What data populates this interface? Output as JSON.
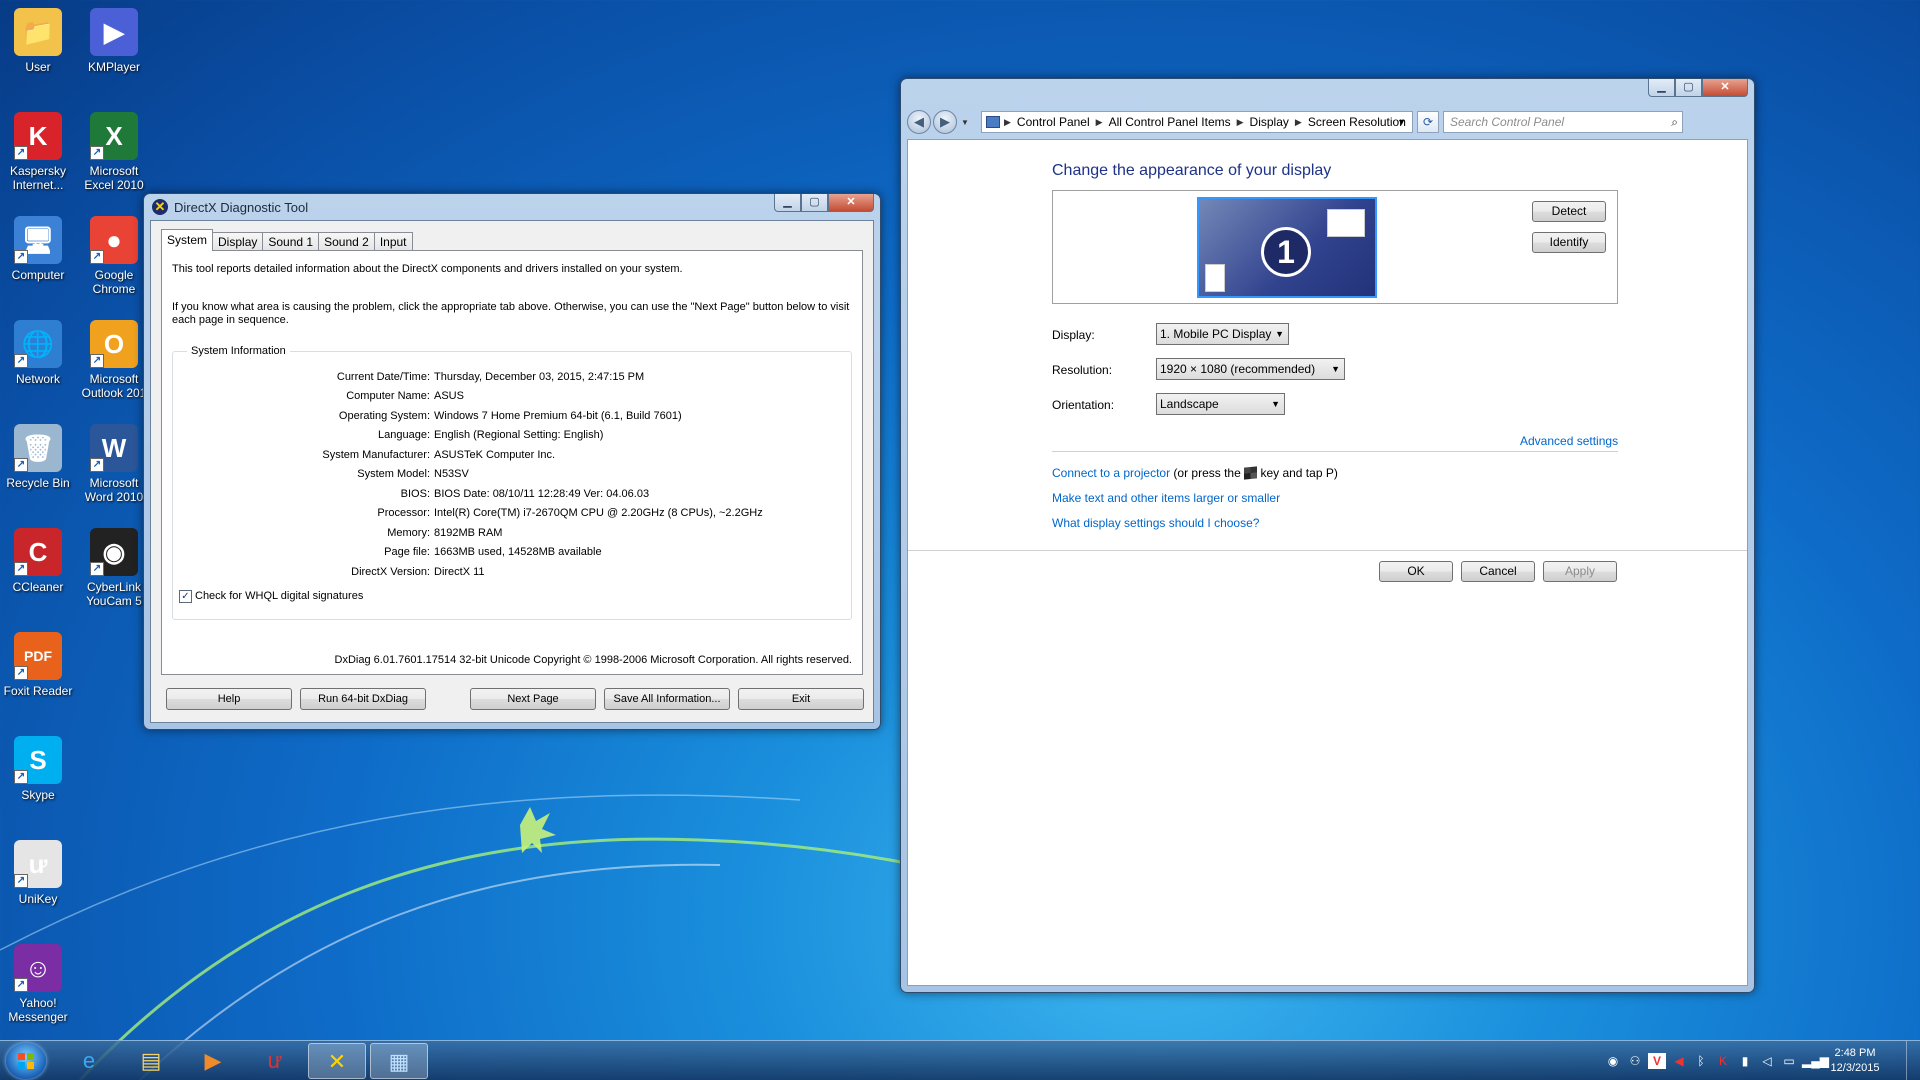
{
  "desktop": {
    "icons": [
      {
        "label": "User",
        "glyph": "📁"
      },
      {
        "label": "KMPlayer",
        "glyph": "▶"
      },
      {
        "label": "Kaspersky Internet...",
        "glyph": "K"
      },
      {
        "label": "Microsoft Excel 2010",
        "glyph": "X"
      },
      {
        "label": "Computer",
        "glyph": "🖥"
      },
      {
        "label": "Google Chrome",
        "glyph": "●"
      },
      {
        "label": "Network",
        "glyph": "🌐"
      },
      {
        "label": "Microsoft Outlook 201",
        "glyph": "O"
      },
      {
        "label": "Recycle Bin",
        "glyph": "🗑"
      },
      {
        "label": "Microsoft Word 2010",
        "glyph": "W"
      },
      {
        "label": "CCleaner",
        "glyph": "C"
      },
      {
        "label": "CyberLink YouCam 5",
        "glyph": "◉"
      },
      {
        "label": "Foxit Reader",
        "glyph": "PDF"
      },
      {
        "label": "Skype",
        "glyph": "S"
      },
      {
        "label": "UniKey",
        "glyph": "ư"
      },
      {
        "label": "Yahoo! Messenger",
        "glyph": "☺"
      }
    ]
  },
  "dxdiag": {
    "title": "DirectX Diagnostic Tool",
    "tabs": [
      "System",
      "Display",
      "Sound 1",
      "Sound 2",
      "Input"
    ],
    "intro1": "This tool reports detailed information about the DirectX components and drivers installed on your system.",
    "intro2": "If you know what area is causing the problem, click the appropriate tab above.  Otherwise, you can use the \"Next Page\" button below to visit each page in sequence.",
    "group_title": "System Information",
    "rows": [
      {
        "label": "Current Date/Time:",
        "value": "Thursday, December 03, 2015, 2:47:15 PM"
      },
      {
        "label": "Computer Name:",
        "value": "ASUS"
      },
      {
        "label": "Operating System:",
        "value": "Windows 7 Home Premium 64-bit (6.1, Build 7601)"
      },
      {
        "label": "Language:",
        "value": "English (Regional Setting: English)"
      },
      {
        "label": "System Manufacturer:",
        "value": "ASUSTeK Computer Inc."
      },
      {
        "label": "System Model:",
        "value": "N53SV"
      },
      {
        "label": "BIOS:",
        "value": "BIOS Date: 08/10/11 12:28:49 Ver: 04.06.03"
      },
      {
        "label": "Processor:",
        "value": "Intel(R) Core(TM) i7-2670QM CPU @ 2.20GHz (8 CPUs), ~2.2GHz"
      },
      {
        "label": "Memory:",
        "value": "8192MB RAM"
      },
      {
        "label": "Page file:",
        "value": "1663MB used, 14528MB available"
      },
      {
        "label": "DirectX Version:",
        "value": "DirectX 11"
      }
    ],
    "whql_label": "Check for WHQL digital signatures",
    "whql_checked": true,
    "copyright": "DxDiag 6.01.7601.17514 32-bit Unicode  Copyright © 1998-2006 Microsoft Corporation.  All rights reserved.",
    "buttons": {
      "help": "Help",
      "run64": "Run 64-bit DxDiag",
      "next": "Next Page",
      "save": "Save All Information...",
      "exit": "Exit"
    }
  },
  "control_panel": {
    "breadcrumb": [
      "Control Panel",
      "All Control Panel Items",
      "Display",
      "Screen Resolution"
    ],
    "search_placeholder": "Search Control Panel",
    "heading": "Change the appearance of your display",
    "monitor_number": "1",
    "detect": "Detect",
    "identify": "Identify",
    "display_label": "Display:",
    "display_value": "1. Mobile PC Display",
    "resolution_label": "Resolution:",
    "resolution_value": "1920 × 1080 (recommended)",
    "orientation_label": "Orientation:",
    "orientation_value": "Landscape",
    "advanced": "Advanced settings",
    "projector_link": "Connect to a projector",
    "projector_rest_a": " (or press the ",
    "projector_rest_b": " key and tap P)",
    "link_text_size": "Make text and other items larger or smaller",
    "link_help": "What display settings should I choose?",
    "ok": "OK",
    "cancel": "Cancel",
    "apply": "Apply"
  },
  "taskbar": {
    "clock_time": "2:48 PM",
    "clock_date": "12/3/2015"
  }
}
